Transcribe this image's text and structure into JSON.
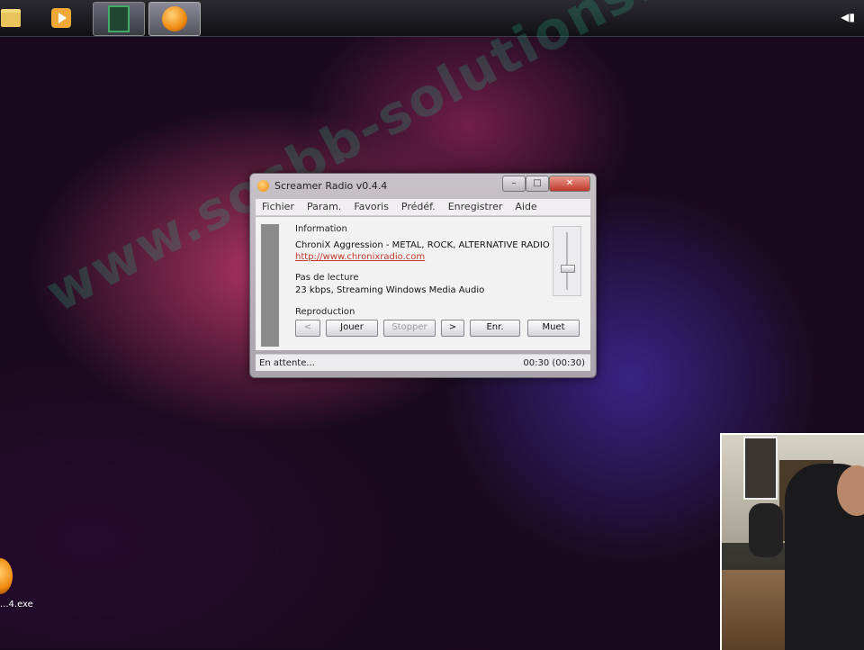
{
  "taskbar": {
    "apps": [
      {
        "icon": "folder-icon"
      },
      {
        "icon": "media-player-icon"
      },
      {
        "icon": "film-icon"
      },
      {
        "icon": "screamer-radio-icon"
      }
    ],
    "tray_icon": "speaker-icon"
  },
  "watermark": "www.sosbb-solutions.fr",
  "desktop_icon": {
    "label": "...4.exe",
    "icon": "screamer-radio-icon"
  },
  "window": {
    "title": "Screamer Radio v0.4.4",
    "controls": {
      "minimize": "–",
      "maximize": "□",
      "close": "✕"
    },
    "menu": [
      "Fichier",
      "Param.",
      "Favoris",
      "Prédéf.",
      "Enregistrer",
      "Aide"
    ],
    "information_label": "Information",
    "station_name": "ChroniX Aggression - METAL, ROCK, ALTERNATIVE RADIO",
    "station_url": "http://www.chronixradio.com",
    "playback_status_label": "Pas de lecture",
    "stream_info": "23 kbps, Streaming Windows Media Audio",
    "reproduction_label": "Reproduction",
    "buttons": {
      "prev": "<",
      "play": "Jouer",
      "stop": "Stopper",
      "next": ">",
      "record": "Enr.",
      "mute": "Muet"
    },
    "status_text": "En attente...",
    "time_text": "00:30 (00:30)"
  },
  "colors": {
    "accent": "#f08a10",
    "link": "#c0392b"
  }
}
